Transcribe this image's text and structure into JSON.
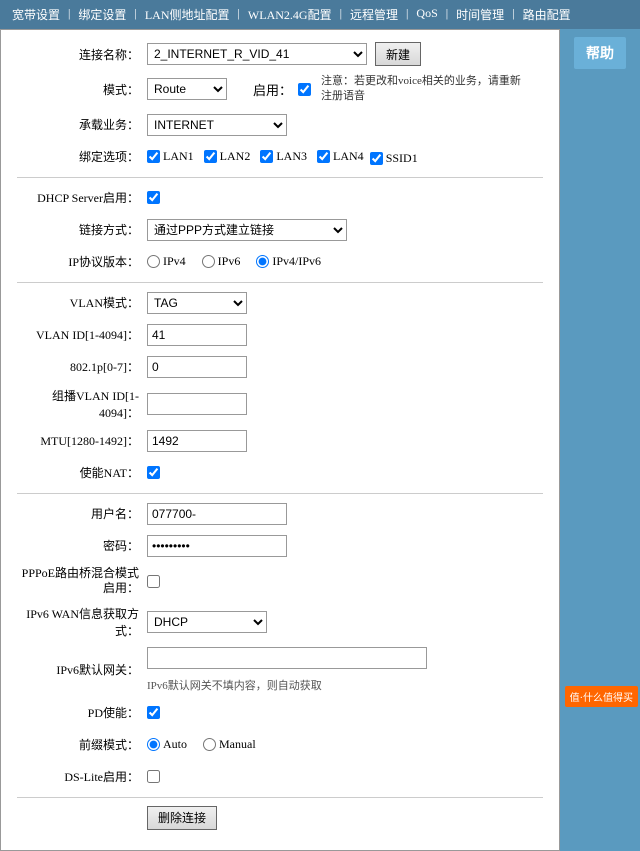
{
  "nav": {
    "items": [
      "宽带设置",
      "绑定设置",
      "LAN侧地址配置",
      "WLAN2.4G配置",
      "远程管理",
      "QoS",
      "时间管理",
      "路由配置"
    ]
  },
  "sidebar": {
    "help_label": "帮助"
  },
  "form": {
    "connection_name_label": "连接名称：",
    "connection_name_value": "2_INTERNET_R_VID_41",
    "new_button": "新建",
    "mode_label": "模式：",
    "mode_value": "Route",
    "enable_label": "启用：",
    "service_label": "承载业务：",
    "service_value": "INTERNET",
    "note_text": "注意：若更改和voice相关的业务，请重新注册语音",
    "binding_label": "绑定选项：",
    "lan1": "LAN1",
    "lan2": "LAN2",
    "lan3": "LAN3",
    "lan4": "LAN4",
    "ssid1": "SSID1",
    "dhcp_label": "DHCP Server启用：",
    "link_mode_label": "链接方式：",
    "link_mode_value": "通过PPP方式建立链接",
    "ip_proto_label": "IP协议版本：",
    "ipv4_label": "IPv4",
    "ipv6_label": "IPv6",
    "ipv4ipv6_label": "IPv4/IPv6",
    "vlan_mode_label": "VLAN模式：",
    "vlan_mode_value": "TAG",
    "vlan_id_label": "VLAN ID[1-4094]：",
    "vlan_id_value": "41",
    "8021p_label": "802.1p[0-7]：",
    "8021p_value": "0",
    "multicast_vlan_label": "组播VLAN ID[1-4094]：",
    "multicast_vlan_value": "",
    "mtu_label": "MTU[1280-1492]：",
    "mtu_value": "1492",
    "nat_label": "使能NAT：",
    "username_label": "用户名：",
    "username_value": "077700-",
    "password_label": "密码：",
    "password_value": "•••••••••",
    "pppoe_bridge_label": "PPPoE路由桥混合模式启用：",
    "ipv6_wan_label": "IPv6 WAN信息获取方式：",
    "ipv6_wan_value": "DHCP",
    "ipv6_gateway_label": "IPv6默认网关：",
    "ipv6_gateway_value": "",
    "ipv6_gateway_hint": "IPv6默认网关不填内容，则自动获取",
    "pd_enable_label": "PD使能：",
    "prefix_mode_label": "前缀模式：",
    "prefix_auto": "Auto",
    "prefix_manual": "Manual",
    "ds_lite_label": "DS-Lite启用：",
    "delete_button": "删除连接"
  },
  "watermark": "值·什么值得买"
}
